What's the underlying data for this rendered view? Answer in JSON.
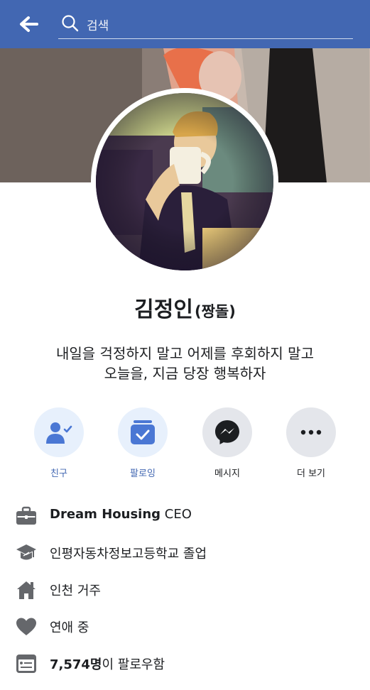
{
  "topbar": {
    "search_placeholder": "검색",
    "color": "#4267b2"
  },
  "profile": {
    "name": "김정인",
    "nickname": "(짱돌)",
    "bio_line1": "내일을 걱정하지 말고 어제를 후회하지 말고",
    "bio_line2": "오늘을, 지금 당장 행복하자"
  },
  "actions": [
    {
      "label": "친구",
      "icon": "friend-check-icon",
      "color": "#4267b2"
    },
    {
      "label": "팔로잉",
      "icon": "following-check-icon",
      "color": "#4267b2"
    },
    {
      "label": "메시지",
      "icon": "messenger-icon",
      "color": "#1c1e21"
    },
    {
      "label": "더 보기",
      "icon": "more-dots-icon",
      "color": "#1c1e21"
    }
  ],
  "info": {
    "work_company": "Dream Housing",
    "work_role": " CEO",
    "education": "인평자동차정보고등학교 졸업",
    "location": "인천 거주",
    "relationship": "연애 중",
    "followers_count": "7,574명",
    "followers_suffix": "이 팔로우함"
  }
}
